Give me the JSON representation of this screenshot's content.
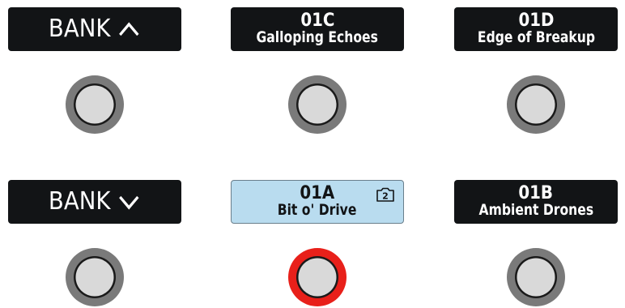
{
  "footswitches": {
    "bank_up": {
      "label": "BANK",
      "icon": "chevron-up-icon"
    },
    "bank_down": {
      "label": "BANK",
      "icon": "chevron-down-icon"
    },
    "preset_01c": {
      "number": "01C",
      "name": "Galloping Echoes"
    },
    "preset_01d": {
      "number": "01D",
      "name": "Edge of Breakup"
    },
    "preset_01a": {
      "number": "01A",
      "name": "Bit o' Drive",
      "snapshot": "2",
      "selected": true
    },
    "preset_01b": {
      "number": "01B",
      "name": "Ambient Drones"
    }
  },
  "colors": {
    "lcd_background": "#121416",
    "lcd_text": "#ffffff",
    "lcd_selected_background": "#b9dcef",
    "switch_ring": "#7a7a7a",
    "switch_ring_active": "#e8201a",
    "switch_cap": "#d9d9d9"
  }
}
